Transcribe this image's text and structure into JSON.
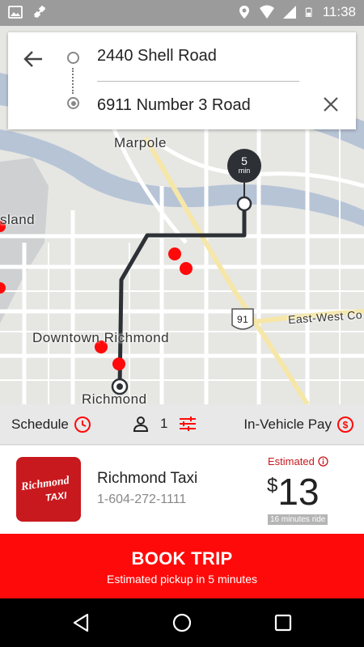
{
  "status_bar": {
    "time": "11:38",
    "icons": [
      "image-icon",
      "no-signal-icon",
      "location-icon",
      "wifi-icon",
      "signal-icon",
      "battery-icon"
    ]
  },
  "route": {
    "from": "2440 Shell Road",
    "to": "6911 Number 3 Road"
  },
  "map": {
    "labels": {
      "marpole": "Marpole",
      "island": "sland",
      "east_west": "East-West Co",
      "downtown": "Downtown Richmond",
      "richmond": "Richmond",
      "highway": "91"
    },
    "eta": {
      "value": "5",
      "unit": "min"
    }
  },
  "options": {
    "schedule": "Schedule",
    "passengers": "1",
    "payment": "In-Vehicle Pay"
  },
  "company": {
    "logo_text_1": "Richmond",
    "logo_text_2": "TAXI",
    "name": "Richmond Taxi",
    "phone": "1-604-272-1111",
    "estimated_label": "Estimated",
    "currency": "$",
    "price": "13",
    "ride_time": "16 minutes ride"
  },
  "book": {
    "title": "BOOK TRIP",
    "subtitle": "Estimated pickup in 5 minutes"
  },
  "colors": {
    "accent": "#ff0a0a",
    "brand": "#c8191e",
    "route": "#2d3135"
  }
}
